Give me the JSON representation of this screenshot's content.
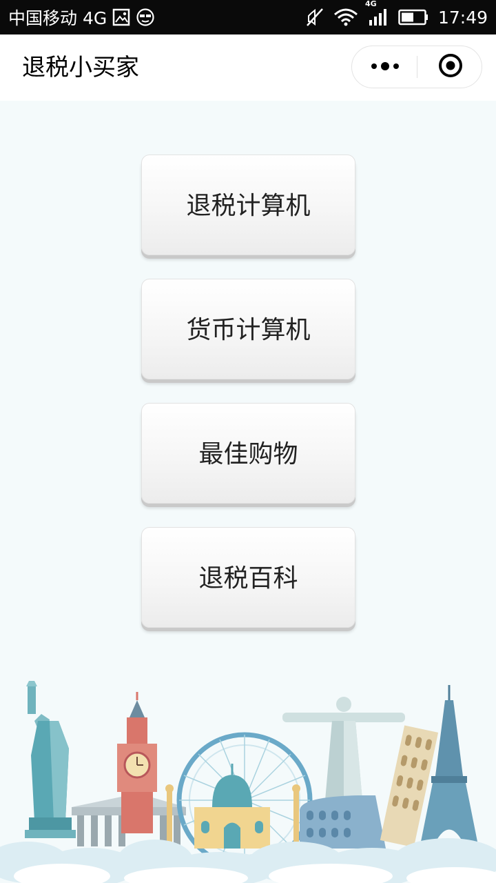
{
  "status_bar": {
    "carrier": "中国移动 4G",
    "network_badge": "4G",
    "time": "17:49",
    "icons": [
      "image-icon",
      "glasses-face-icon",
      "mute-icon",
      "wifi-icon",
      "signal-icon",
      "battery-icon"
    ]
  },
  "nav": {
    "title": "退税小买家",
    "more_icon": "more-dots-icon",
    "close_icon": "target-close-icon"
  },
  "menu": {
    "items": [
      {
        "label": "退税计算机"
      },
      {
        "label": "货币计算机"
      },
      {
        "label": "最佳购物"
      },
      {
        "label": "退税百科"
      }
    ]
  },
  "theme": {
    "page_background": "#f4fafb",
    "status_bar_background": "#0a0a0a",
    "button_text": "#222222",
    "landmark_teal": "#5aa8b4",
    "landmark_red": "#d9766b",
    "landmark_gold": "#e9c77d"
  },
  "illustration": {
    "landmark_icons": [
      "statue-of-liberty-icon",
      "big-ben-icon",
      "ferris-wheel-icon",
      "taj-mahal-icon",
      "christ-redeemer-icon",
      "colosseum-icon",
      "pisa-tower-icon",
      "eiffel-tower-icon",
      "clouds-icon"
    ]
  }
}
